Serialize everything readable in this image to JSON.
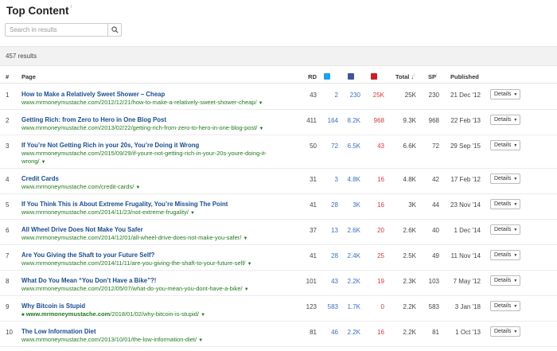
{
  "page": {
    "title": "Top Content",
    "title_info": "i"
  },
  "search": {
    "placeholder": "Search in results"
  },
  "results": {
    "count_label": "457 results"
  },
  "colors": {
    "twitter": "#1da1f2",
    "facebook": "#3b5998",
    "pinterest": "#cb2027",
    "title_link": "#1a4d8f",
    "url": "#1f7a1f"
  },
  "headers": {
    "num": "#",
    "page": "Page",
    "rd": "RD",
    "total": "Total",
    "sort_indicator": "↓",
    "sort_info": "i",
    "sp": "SP",
    "sp_info": "i",
    "published": "Published"
  },
  "details_label": "Details",
  "rows": [
    {
      "num": "1",
      "title": "How to Make a Relatively Sweet Shower – Cheap",
      "url": "www.mrmoneymustache.com/2012/12/21/how-to-make-a-relatively-sweet-shower-cheap/",
      "rd": "43",
      "tw": "2",
      "fb": "230",
      "pn": "25K",
      "total": "25K",
      "sp": "230",
      "published": "21 Dec '12"
    },
    {
      "num": "2",
      "title": "Getting Rich: from Zero to Hero in One Blog Post",
      "url": "www.mrmoneymustache.com/2013/02/22/getting-rich-from-zero-to-hero-in-one-blog-post/",
      "rd": "411",
      "tw": "164",
      "fb": "8.2K",
      "pn": "968",
      "total": "9.3K",
      "sp": "968",
      "published": "22 Feb '13"
    },
    {
      "num": "3",
      "title": "If You’re Not Getting Rich in your 20s, You’re Doing it Wrong",
      "url": "www.mrmoneymustache.com/2015/09/29/if-youre-not-getting-rich-in-your-20s-youre-doing-it-",
      "url2": "wrong/",
      "rd": "50",
      "tw": "72",
      "fb": "6.5K",
      "pn": "43",
      "total": "6.6K",
      "sp": "72",
      "published": "29 Sep '15"
    },
    {
      "num": "4",
      "title": "Credit Cards",
      "url": "www.mrmoneymustache.com/credit-cards/",
      "rd": "31",
      "tw": "3",
      "fb": "4.8K",
      "pn": "16",
      "total": "4.8K",
      "sp": "42",
      "published": "17 Feb '12"
    },
    {
      "num": "5",
      "title": "If You Think This is About Extreme Frugality, You’re Missing The Point",
      "url": "www.mrmoneymustache.com/2014/11/23/not-extreme-frugality/",
      "rd": "41",
      "tw": "28",
      "fb": "3K",
      "pn": "16",
      "total": "3K",
      "sp": "44",
      "published": "23 Nov '14"
    },
    {
      "num": "6",
      "title": "All Wheel Drive Does Not Make You Safer",
      "url": "www.mrmoneymustache.com/2014/12/01/all-wheel-drive-does-not-make-you-safer/",
      "rd": "37",
      "tw": "13",
      "fb": "2.6K",
      "pn": "20",
      "total": "2.6K",
      "sp": "40",
      "published": "1 Dec '14"
    },
    {
      "num": "7",
      "title": "Are You Giving the Shaft to your Future Self?",
      "url": "www.mrmoneymustache.com/2014/11/11/are-you-giving-the-shaft-to-your-future-self/",
      "rd": "41",
      "tw": "28",
      "fb": "2.4K",
      "pn": "25",
      "total": "2.5K",
      "sp": "49",
      "published": "11 Nov '14"
    },
    {
      "num": "8",
      "title": "What Do You Mean “You Don’t Have a Bike”?!",
      "url": "www.mrmoneymustache.com/2012/05/07/what-do-you-mean-you-dont-have-a-bike/",
      "rd": "101",
      "tw": "43",
      "fb": "2.2K",
      "pn": "19",
      "total": "2.3K",
      "sp": "103",
      "published": "7 May '12"
    },
    {
      "num": "9",
      "title": "Why Bitcoin is Stupid",
      "url_domain": "www.mrmoneymustache.com",
      "url": "/2018/01/02/why-bitcoin-is-stupid/",
      "rd": "123",
      "tw": "583",
      "fb": "1.7K",
      "pn": "0",
      "total": "2.2K",
      "sp": "583",
      "published": "3 Jan '18"
    },
    {
      "num": "10",
      "title": "The Low Information Diet",
      "url": "www.mrmoneymustache.com/2013/10/01/the-low-information-diet/",
      "rd": "81",
      "tw": "46",
      "fb": "2.2K",
      "pn": "16",
      "total": "2.2K",
      "sp": "81",
      "published": "1 Oct '13"
    }
  ]
}
